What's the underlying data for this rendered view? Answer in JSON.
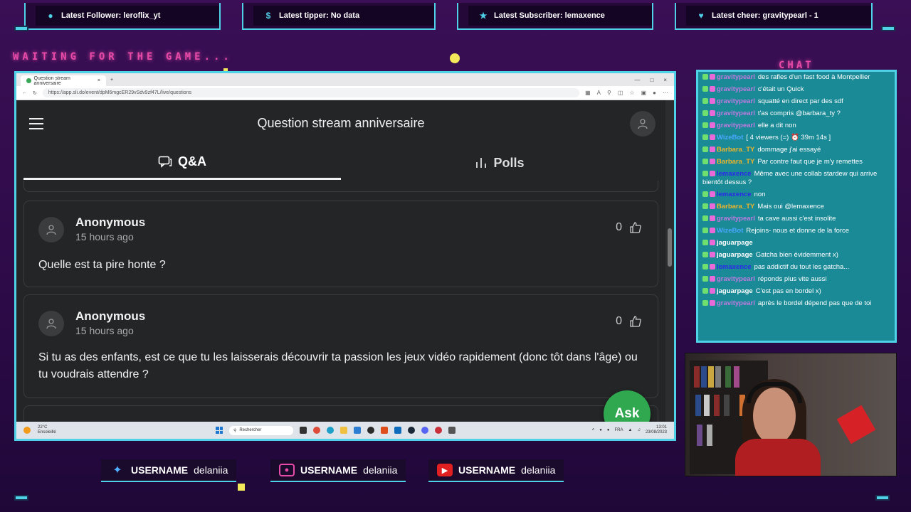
{
  "overlay": {
    "alerts": [
      {
        "icon": "user-icon",
        "label": "Latest Follower: leroflix_yt"
      },
      {
        "icon": "dollar-icon",
        "label": "Latest tipper: No data"
      },
      {
        "icon": "star-icon",
        "label": "Latest Subscriber: lemaxence"
      },
      {
        "icon": "heart-icon",
        "label": "Latest cheer: gravitypearl - 1"
      }
    ],
    "waiting_text": "WAITING FOR THE GAME...",
    "chat_title": "CHAT",
    "socials": [
      {
        "icon": "twitter-icon",
        "handle_label": "USERNAME",
        "handle": "delaniia"
      },
      {
        "icon": "instagram-icon",
        "handle_label": "USERNAME",
        "handle": "delaniia"
      },
      {
        "icon": "youtube-icon",
        "handle_label": "USERNAME",
        "handle": "delaniia"
      }
    ]
  },
  "browser": {
    "tab_title": "Question stream anniversaire",
    "url": "https://app.sli.do/event/dpM6mgcER29vSdv9zf47L/live/questions"
  },
  "app": {
    "title": "Question stream anniversaire",
    "tabs": [
      {
        "label": "Q&A",
        "icon": "chat-bubble-icon",
        "active": true
      },
      {
        "label": "Polls",
        "icon": "bar-chart-icon",
        "active": false
      }
    ],
    "questions": [
      {
        "author": "Anonymous",
        "time": "15 hours ago",
        "likes": "0",
        "text": "Quelle est ta pire honte ?"
      },
      {
        "author": "Anonymous",
        "time": "15 hours ago",
        "likes": "0",
        "text": "Si tu as des enfants, est ce que tu les laisserais découvrir ta passion les jeux vidéo rapidement (donc tôt dans l'âge) ou tu voudrais attendre ?"
      }
    ],
    "ask_label": "Ask"
  },
  "taskbar": {
    "weather_temp": "22°C",
    "weather_desc": "Ensoleillé",
    "search_placeholder": "Rechercher",
    "lang": "FRA",
    "time": "13:01",
    "date": "23/08/2023"
  },
  "chat": {
    "messages": [
      {
        "user": "gravitypearl",
        "color": "#c07ae0",
        "text": "des rafles d'un fast food à Montpellier"
      },
      {
        "user": "gravitypearl",
        "color": "#c07ae0",
        "text": "c'était un Quick"
      },
      {
        "user": "gravitypearl",
        "color": "#c07ae0",
        "text": "squatté en direct par des sdf"
      },
      {
        "user": "gravitypearl",
        "color": "#c07ae0",
        "text": "t'as compris @barbara_ty ?"
      },
      {
        "user": "gravitypearl",
        "color": "#c07ae0",
        "text": "elle a dit non"
      },
      {
        "user": "WizeBot",
        "color": "#4aa8ff",
        "text": "[ 4 viewers (=) ⏰ 39m 14s ]"
      },
      {
        "user": "Barbara_TY",
        "color": "#f0b429",
        "text": "dommage j'ai essayé"
      },
      {
        "user": "Barbara_TY",
        "color": "#f0b429",
        "text": "Par contre faut que je m'y remettes"
      },
      {
        "user": "lemaxence",
        "color": "#2a2ae8",
        "text": "Même avec une collab stardew qui arrive bientôt dessus ?"
      },
      {
        "user": "lemaxence",
        "color": "#2a2ae8",
        "text": "non"
      },
      {
        "user": "Barbara_TY",
        "color": "#f0b429",
        "text": "Mais oui @lemaxence"
      },
      {
        "user": "gravitypearl",
        "color": "#c07ae0",
        "text": "ta cave aussi c'est insolite"
      },
      {
        "user": "WizeBot",
        "color": "#4aa8ff",
        "text": "Rejoins- nous et donne de la force"
      },
      {
        "user": "jaguarpage",
        "color": "#ffffff",
        "text": ""
      },
      {
        "user": "jaguarpage",
        "color": "#ffffff",
        "text": "Gatcha bien évidemment x)"
      },
      {
        "user": "lemaxence",
        "color": "#2a2ae8",
        "text": "pas addictif du tout les gatcha..."
      },
      {
        "user": "gravitypearl",
        "color": "#c07ae0",
        "text": "réponds plus vite aussi"
      },
      {
        "user": "jaguarpage",
        "color": "#ffffff",
        "text": "C'est pas en bordel x)"
      },
      {
        "user": "gravitypearl",
        "color": "#c07ae0",
        "text": "après le bordel dépend pas que de toi"
      }
    ]
  }
}
